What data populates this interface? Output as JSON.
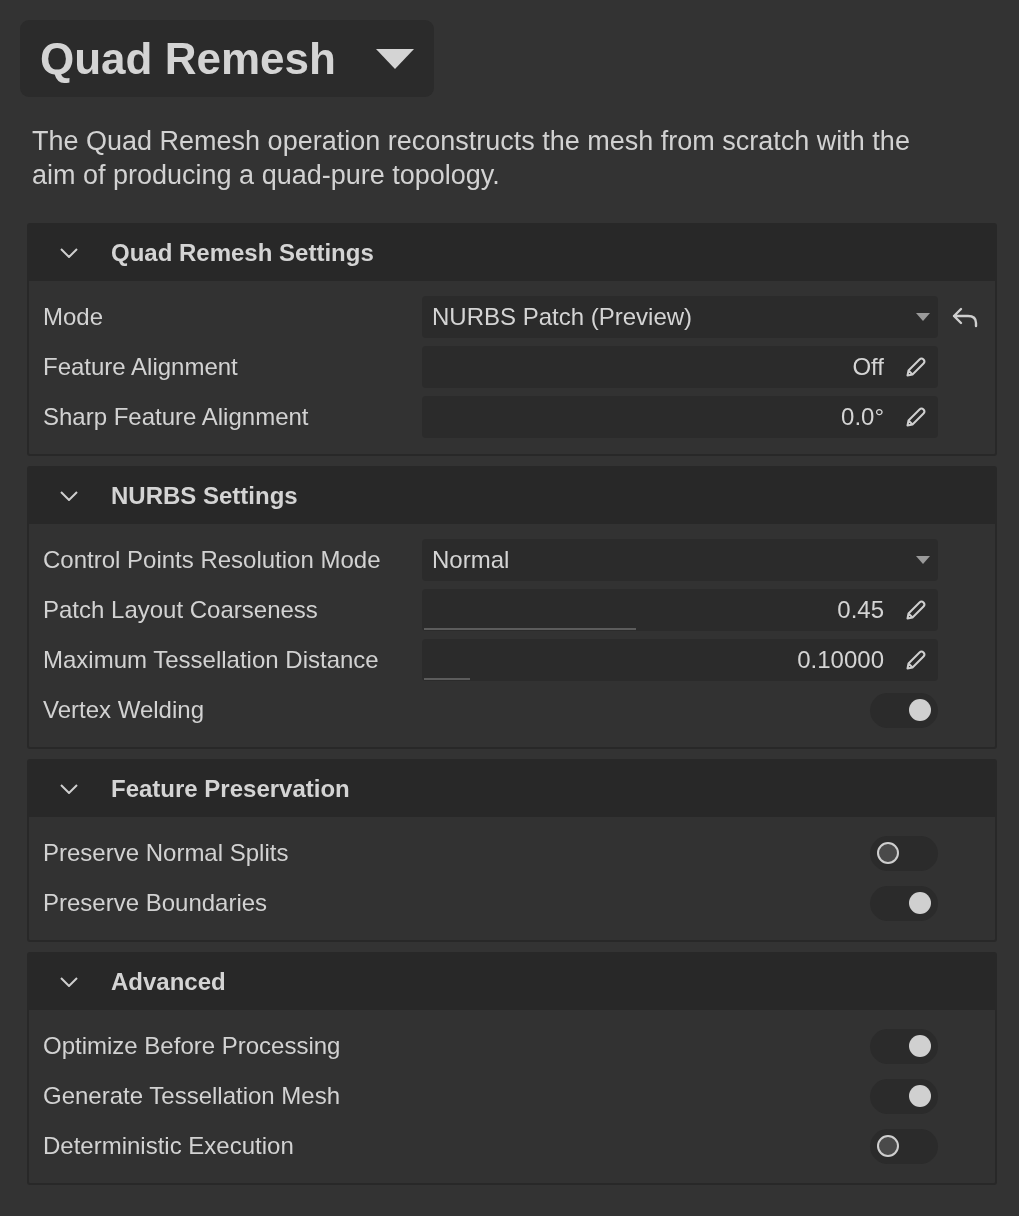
{
  "title": {
    "text": "Quad Remesh"
  },
  "description": "The Quad Remesh operation reconstructs the mesh from scratch with the aim of producing a quad-pure topology.",
  "sections": [
    {
      "title": "Quad Remesh Settings",
      "expanded": true,
      "rows": [
        {
          "kind": "dropdown",
          "label": "Mode",
          "value": "NURBS Patch (Preview)",
          "resettable": true
        },
        {
          "kind": "field",
          "label": "Feature Alignment",
          "value": "Off"
        },
        {
          "kind": "field",
          "label": "Sharp Feature Alignment",
          "value": "0.0°"
        }
      ]
    },
    {
      "title": "NURBS Settings",
      "expanded": true,
      "rows": [
        {
          "kind": "dropdown",
          "label": "Control Points Resolution Mode",
          "value": "Normal",
          "resettable": false
        },
        {
          "kind": "slider",
          "label": "Patch Layout Coarseness",
          "value": "0.45",
          "level": 0.41
        },
        {
          "kind": "slider",
          "label": "Maximum Tessellation Distance",
          "value": "0.10000",
          "level": 0.09
        },
        {
          "kind": "toggle",
          "label": "Vertex Welding",
          "on": true
        }
      ]
    },
    {
      "title": "Feature Preservation",
      "expanded": true,
      "rows": [
        {
          "kind": "toggle",
          "label": "Preserve Normal Splits",
          "on": false
        },
        {
          "kind": "toggle",
          "label": "Preserve Boundaries",
          "on": true
        }
      ]
    },
    {
      "title": "Advanced",
      "expanded": true,
      "rows": [
        {
          "kind": "toggle",
          "label": "Optimize Before Processing",
          "on": true
        },
        {
          "kind": "toggle",
          "label": "Generate Tessellation Mesh",
          "on": true
        },
        {
          "kind": "toggle",
          "label": "Deterministic Execution",
          "on": false
        }
      ]
    }
  ]
}
